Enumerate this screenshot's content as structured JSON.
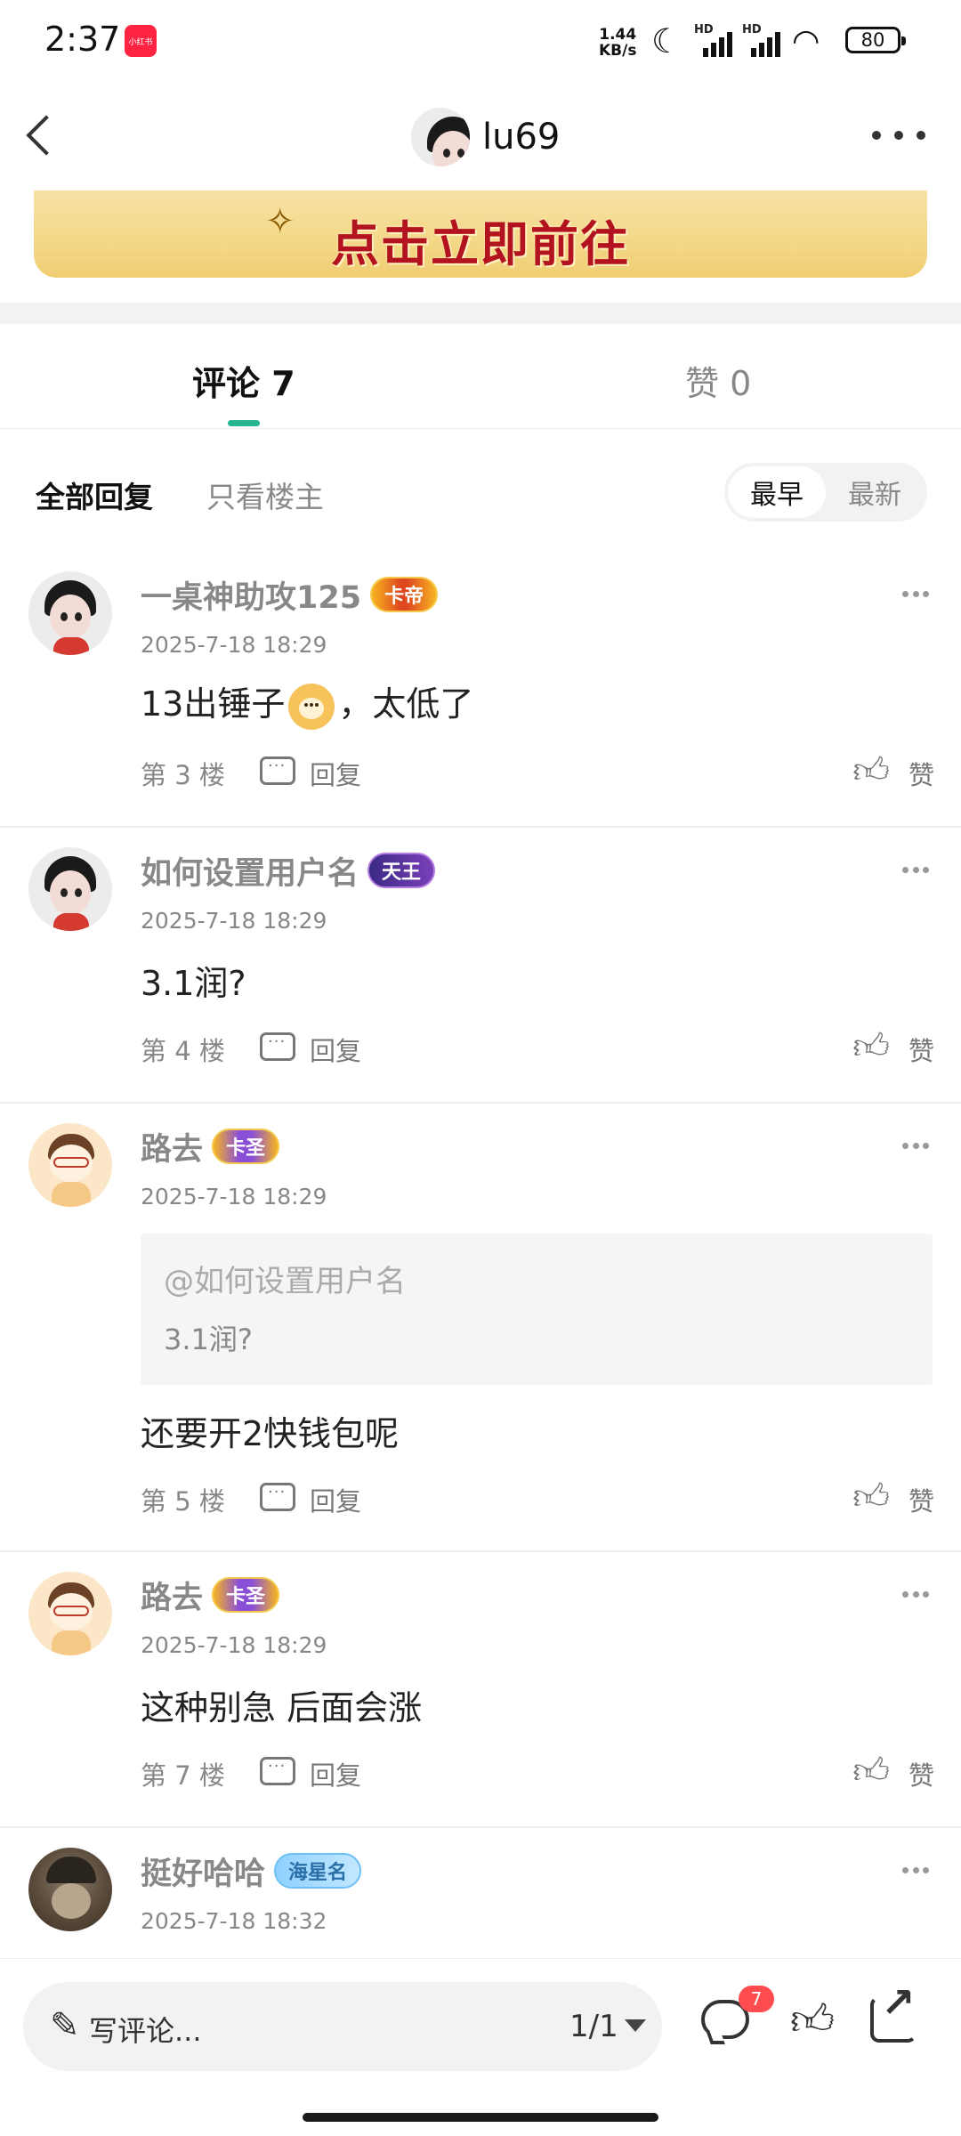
{
  "status_bar": {
    "time": "2:37",
    "app_badge": "小红书",
    "net_speed": "1.44",
    "net_unit": "KB/s",
    "hd1": "HD",
    "hd2": "HD",
    "battery": "80"
  },
  "header": {
    "username": "lu69"
  },
  "banner": {
    "text": "点击立即前往"
  },
  "tabs": {
    "comments_label": "评论 7",
    "likes_label": "赞 0"
  },
  "filters": {
    "all_replies": "全部回复",
    "op_only": "只看楼主",
    "sort_earliest": "最早",
    "sort_latest": "最新"
  },
  "comments": [
    {
      "name": "一桌神助攻125",
      "badge": "卡帝",
      "time": "2025-7-18 18:29",
      "content_before": "13出锤子",
      "content_after": "，太低了",
      "floor": "第 3 楼",
      "reply_label": "回复",
      "like_label": "赞"
    },
    {
      "name": "如何设置用户名",
      "badge": "天王",
      "time": "2025-7-18 18:29",
      "content": "3.1润?",
      "floor": "第 4 楼",
      "reply_label": "回复",
      "like_label": "赞"
    },
    {
      "name": "路去",
      "badge": "卡圣",
      "time": "2025-7-18 18:29",
      "quote_user": "@如何设置用户名",
      "quote_text": "3.1润?",
      "content": "还要开2快钱包呢",
      "floor": "第 5 楼",
      "reply_label": "回复",
      "like_label": "赞"
    },
    {
      "name": "路去",
      "badge": "卡圣",
      "time": "2025-7-18 18:29",
      "content": "这种别急 后面会涨",
      "floor": "第 7 楼",
      "reply_label": "回复",
      "like_label": "赞"
    },
    {
      "name": "挺好哈哈",
      "badge": "海星名",
      "time": "2025-7-18 18:32"
    }
  ],
  "bottom_bar": {
    "placeholder": "写评论...",
    "page": "1/1",
    "comment_count_badge": "7"
  },
  "colors": {
    "accent": "#26b491",
    "banner_text": "#b3131e",
    "badge_red": "#ff4d4f"
  }
}
